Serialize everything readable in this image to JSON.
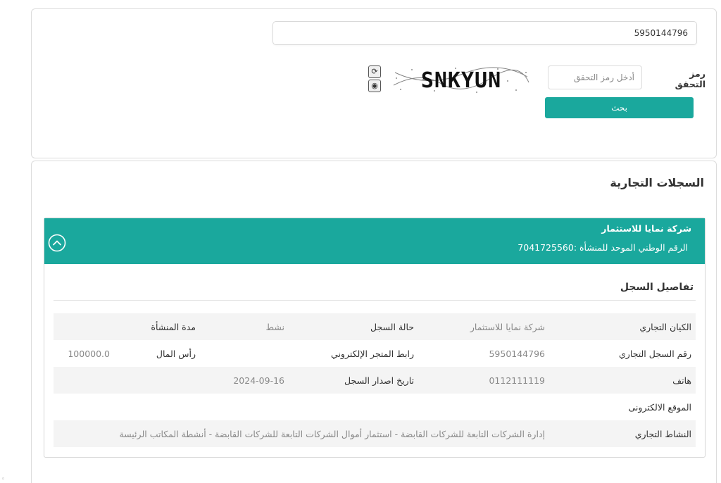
{
  "search": {
    "query_value": "5950144796",
    "captcha_label": "رمز التحقق",
    "captcha_placeholder": "أدخل رمز التحقق",
    "captcha_text": "SNKYUN",
    "search_button_label": "بحث"
  },
  "results": {
    "title": "السجلات التجارية",
    "company": {
      "name": "شركة نمايا للاستثمار",
      "national_id_text": "الرقم الوطني الموحد للمنشأة :7041725560"
    },
    "details": {
      "title": "تفاصيل السجل",
      "rows": [
        [
          "الكيان التجاري",
          "شركة نمايا للاستثمار",
          "حالة السجل",
          "نشط",
          "مدة المنشأة",
          ""
        ],
        [
          "رقم السجل التجاري",
          "5950144796",
          "رابط المتجر الإلكتروني",
          "",
          "رأس المال",
          "100000.0"
        ],
        [
          "هاتف",
          "0112111119",
          "تاريخ اصدار السجل",
          "2024-09-16",
          "",
          ""
        ],
        [
          "الموقع الالكترونى",
          "",
          "",
          "",
          "",
          ""
        ]
      ],
      "activity_label": "النشاط التجاري",
      "activity_value": "إدارة الشركات التابعة للشركات القابضة - استثمار أموال الشركات التابعة للشركات القابضة - أنشطة المكاتب الرئيسة"
    }
  },
  "colors": {
    "accent": "#1aa89d"
  }
}
